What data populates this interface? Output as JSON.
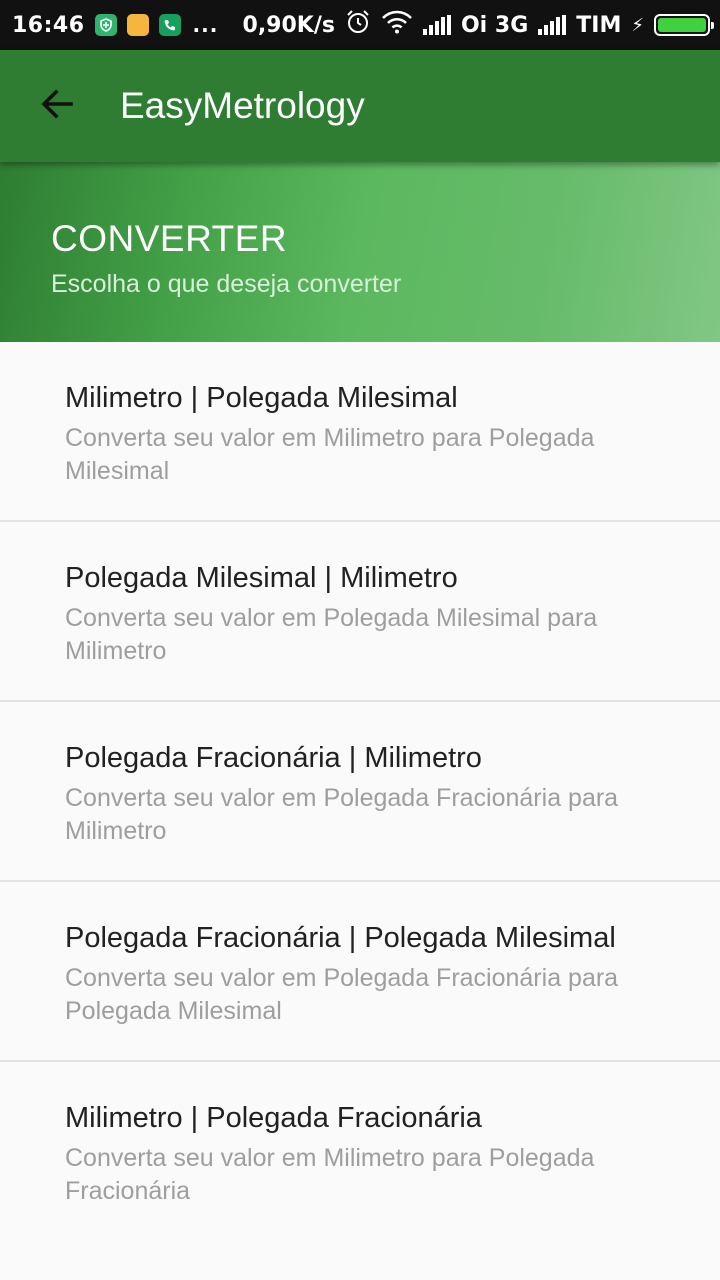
{
  "status_bar": {
    "time": "16:46",
    "dots": "...",
    "speed": "0,90K/s",
    "carrier1": "Oi 3G",
    "carrier2": "TIM",
    "icons": [
      "shield-icon",
      "note-icon",
      "phone-icon",
      "alarm-icon",
      "wifi-icon",
      "signal-icon",
      "battery-icon"
    ]
  },
  "app_bar": {
    "title": "EasyMetrology",
    "color": "#2e7d32"
  },
  "banner": {
    "title": "CONVERTER",
    "subtitle": "Escolha o que deseja converter"
  },
  "list": {
    "items": [
      {
        "title": "Milimetro | Polegada Milesimal",
        "description": "Converta seu valor em Milimetro para Polegada Milesimal"
      },
      {
        "title": "Polegada Milesimal | Milimetro",
        "description": "Converta seu valor em Polegada Milesimal para Milimetro"
      },
      {
        "title": "Polegada Fracionária | Milimetro",
        "description": "Converta seu valor em Polegada Fracionária para Milimetro"
      },
      {
        "title": "Polegada Fracionária | Polegada Milesimal",
        "description": "Converta seu valor em Polegada Fracionária para Polegada Milesimal"
      },
      {
        "title": "Milimetro | Polegada Fracionária",
        "description": "Converta seu valor em Milimetro para Polegada Fracionária"
      }
    ]
  }
}
